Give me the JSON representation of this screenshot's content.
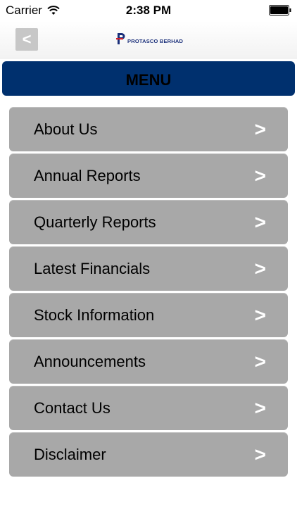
{
  "status_bar": {
    "carrier": "Carrier",
    "time": "2:38 PM"
  },
  "nav": {
    "back_label": "<",
    "logo_text": "PROTASCO BERHAD",
    "logo_color": "#1a2f7a"
  },
  "menu": {
    "title": "MENU",
    "header_color": "#00306e",
    "items": [
      {
        "label": "About Us",
        "chevron": ">"
      },
      {
        "label": "Annual Reports",
        "chevron": ">"
      },
      {
        "label": "Quarterly Reports",
        "chevron": ">"
      },
      {
        "label": "Latest Financials",
        "chevron": ">"
      },
      {
        "label": "Stock Information",
        "chevron": ">"
      },
      {
        "label": "Announcements",
        "chevron": ">"
      },
      {
        "label": "Contact Us",
        "chevron": ">"
      },
      {
        "label": "Disclaimer",
        "chevron": ">"
      }
    ]
  }
}
